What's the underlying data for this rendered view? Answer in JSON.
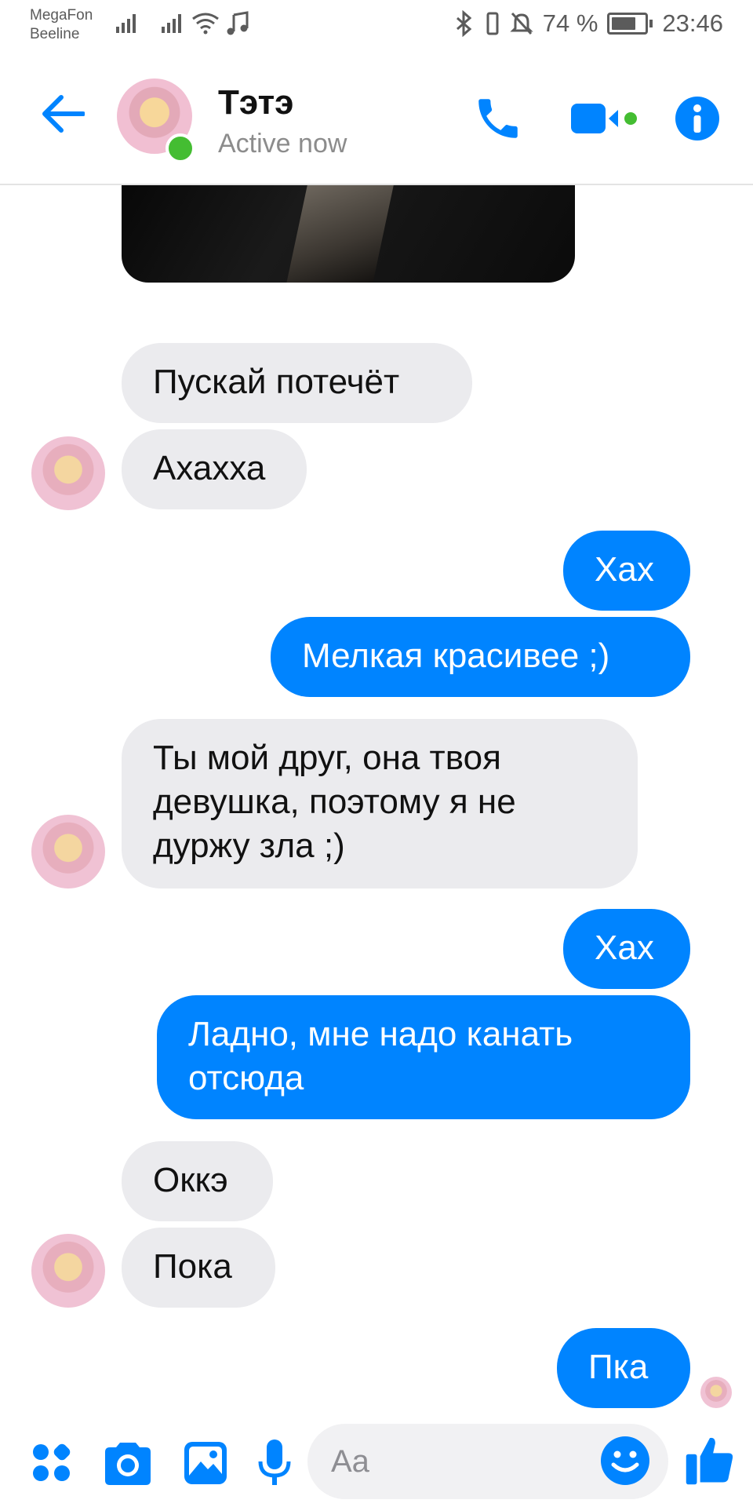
{
  "status_bar": {
    "carrier_1": "MegaFon",
    "carrier_2": "Beeline",
    "battery_percent": "74 %",
    "battery_level": 0.74,
    "time": "23:46"
  },
  "header": {
    "contact_name": "Тэтэ",
    "contact_status": "Active now"
  },
  "colors": {
    "accent": "#0084ff",
    "incoming_bubble": "#ebebee",
    "online": "#44bd32"
  },
  "messages": [
    {
      "from": "them",
      "text": "Пускай потечёт"
    },
    {
      "from": "them",
      "text": "Ахахха"
    },
    {
      "from": "me",
      "text": "Хах"
    },
    {
      "from": "me",
      "text": "Мелкая красивее ;)"
    },
    {
      "from": "them",
      "text": "Ты мой друг, она твоя девушка, поэтому я не дуржу зла ;)"
    },
    {
      "from": "me",
      "text": "Хах"
    },
    {
      "from": "me",
      "text": "Ладно, мне надо канать отсюда"
    },
    {
      "from": "them",
      "text": "Оккэ"
    },
    {
      "from": "them",
      "text": "Пока"
    },
    {
      "from": "me",
      "text": "Пка"
    }
  ],
  "composer": {
    "placeholder": "Aa",
    "icons": [
      "apps-icon",
      "camera-icon",
      "gallery-icon",
      "microphone-icon",
      "emoji-icon",
      "like-icon"
    ]
  }
}
